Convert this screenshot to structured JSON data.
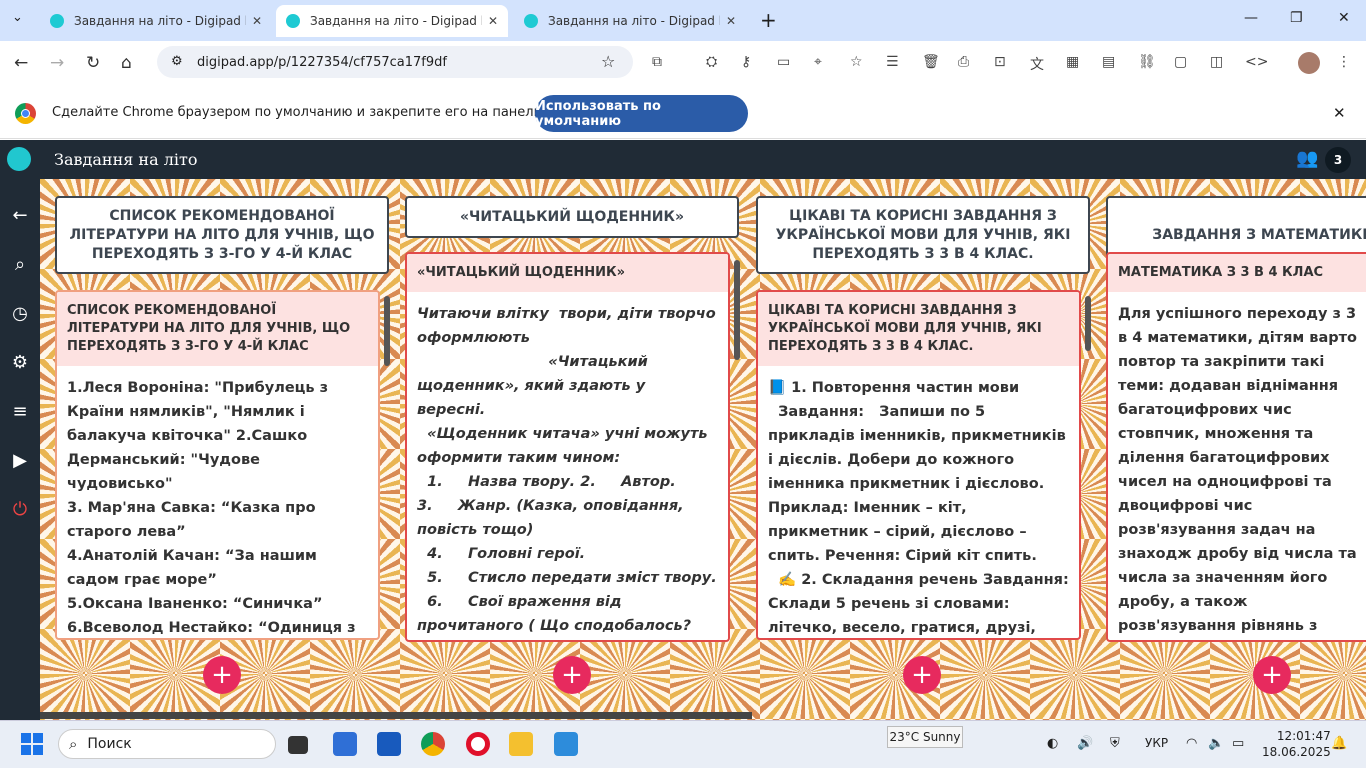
{
  "tabs": [
    {
      "title": "Завдання на літо - Digipad by La",
      "close": "✕"
    },
    {
      "title": "Завдання на літо - Digipad by La",
      "close": "✕"
    },
    {
      "title": "Завдання на літо - Digipad by La",
      "close": "✕"
    }
  ],
  "new_tab": "+",
  "window": {
    "minimize": "—",
    "maximize": "❐",
    "close": "✕"
  },
  "address": {
    "url": "digipad.app/p/1227354/cf757ca17f9df"
  },
  "infobar": {
    "message": "Сделайте Chrome браузером по умолчанию и закрепите его на панели задач.",
    "button": "Использовать по умолчанию",
    "close": "✕"
  },
  "app": {
    "title": "Завдання на літо",
    "user_count": "3"
  },
  "columns": [
    {
      "header": "СПИСОК РЕКОМЕНДОВАНОЇ ЛІТЕРАТУРИ НА ЛІТО ДЛЯ УЧНІВ, ЩО ПЕРЕХОДЯТЬ З 3-ГО У 4-Й КЛАС",
      "card_title": "СПИСОК РЕКОМЕНДОВАНОЇ ЛІТЕРАТУРИ НА ЛІТО ДЛЯ УЧНІВ, ЩО ПЕРЕХОДЯТЬ З 3-ГО У 4-Й КЛАС",
      "card_text": "1.Леся Вороніна: \"Прибулець з Країни нямликів\", \"Нямлик і балакуча квіточка\" 2.Сашко Дерманський: \"Чудове чудовисько\"\n3. Мар'яна Савка: “Казка про старого лева”\n4.Анатолій Качан: “За нашим садом грає море”\n5.Оксана Іваненко: “Синичка”\n6.Всеволод Нестайко: “Одиниця з обманом”, “Супер “Б” з"
    },
    {
      "header": "«ЧИТАЦЬКИЙ ЩОДЕННИК»",
      "card_title": "«ЧИТАЦЬКИЙ ЩОДЕННИК»",
      "card_text": "Читаючи влітку  твори, діти творчо оформлюють\n                          «Читацький щоденник», який здають у вересні.\n  «Щоденник читача» учні можуть оформити таким чином:\n  1.     Назва твору. 2.     Автор.\n3.     Жанр. (Казка, оповідання, повість тощо)\n  4.     Головні герої.\n  5.     Стисло передати зміст твору.\n  6.     Свої враження від прочитаного ( Що сподобалось? Що обурило? Що"
    },
    {
      "header": "ЦІКАВІ ТА КОРИСНІ ЗАВДАННЯ З УКРАЇНСЬКОЇ МОВИ ДЛЯ УЧНІВ, ЯКІ ПЕРЕХОДЯТЬ З 3 В 4 КЛАС.",
      "card_title": "ЦІКАВІ ТА КОРИСНІ ЗАВДАННЯ З УКРАЇНСЬКОЇ МОВИ ДЛЯ УЧНІВ, ЯКІ ПЕРЕХОДЯТЬ З 3 В 4 КЛАС.",
      "card_text": "📘 1. Повторення частин мови\n  Завдання:   Запиши по 5 прикладів іменників, прикметників і дієслів. Добери до кожного іменника прикметник і дієслово. Приклад: Іменник – кіт, прикметник – сірий, дієслово – спить. Речення: Сірий кіт спить.\n  ✍️ 2. Складання речень Завдання: Склади 5 речень зі словами: літечко, весело, гратися, друзі, книжка.  Які"
    },
    {
      "header": "ЗАВДАННЯ З МАТЕМАТИКИ",
      "card_title": "МАТЕМАТИКА З 3 В 4 КЛАС",
      "card_text": "Для успішного переходу з 3 в 4 математики, дітям варто повтор та закріпити такі теми: додаван віднімання багатоцифрових чис стовпчик, множення та ділення багатоцифрових чисел на одноцифрові та двоцифрові чис розв'язування задач на знаходж дробу від числа та числа за значенням його дробу, а також розв'язування рівнянь з однією змінною. Ось декілька конкретн завдань та вправ, які можна використовувати для літнього"
    }
  ],
  "add_label": "+",
  "taskbar": {
    "search": "Поиск",
    "weather": "23°C Sunny",
    "lang": "УКР",
    "time": "12:01:47",
    "date": "18.06.2025"
  }
}
